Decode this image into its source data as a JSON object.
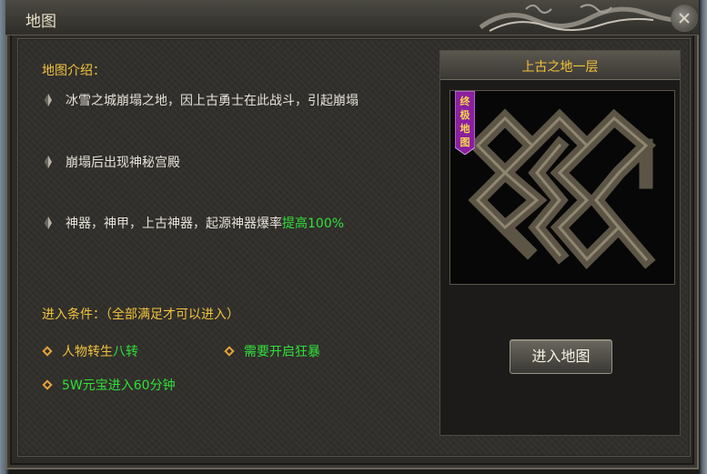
{
  "window": {
    "title": "地图"
  },
  "intro": {
    "heading": "地图介绍：",
    "items": [
      {
        "text": "冰雪之城崩塌之地，因上古勇士在此战斗，引起崩塌",
        "highlight": ""
      },
      {
        "text": "崩塌后出现神秘宫殿",
        "highlight": ""
      },
      {
        "text": "神器，神甲，上古神器，起源神器爆率",
        "highlight": "提高100%"
      }
    ]
  },
  "conditions": {
    "heading": "进入条件：（全部满足才可以进入）",
    "items": [
      {
        "label": "人物转生",
        "value": "八转"
      },
      {
        "label": "",
        "value": "需要开启狂暴"
      },
      {
        "label": "",
        "value": "5W元宝进入60分钟"
      }
    ]
  },
  "map_panel": {
    "title": "上古之地一层",
    "badge": "终极地图",
    "enter_label": "进入地图"
  },
  "colors": {
    "accent": "#f0c33c",
    "highlight": "#2fe03a",
    "text": "#e6e2da"
  }
}
